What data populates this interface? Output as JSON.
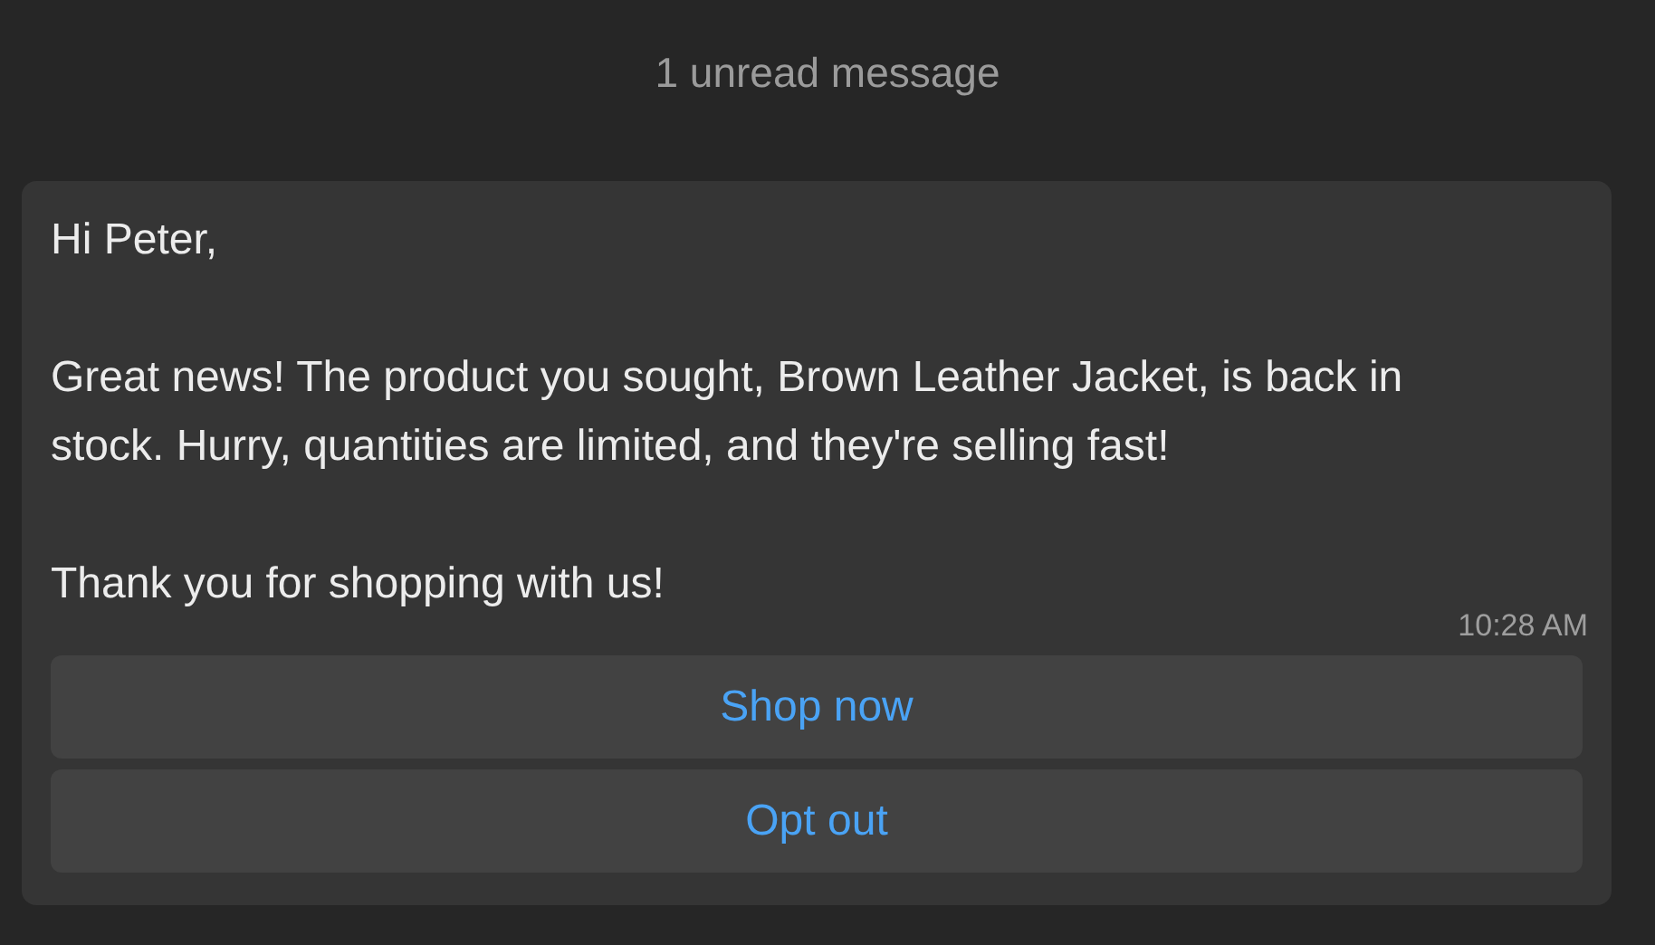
{
  "unread_banner": "1 unread message",
  "message": {
    "paragraphs": [
      "Hi Peter,",
      "Great news! The product you sought, Brown Leather Jacket, is back in stock. Hurry, quantities are limited, and they're selling fast!",
      "Thank you for shopping with us!"
    ],
    "time": "10:28 AM",
    "buttons": [
      "Shop now",
      "Opt out"
    ]
  }
}
